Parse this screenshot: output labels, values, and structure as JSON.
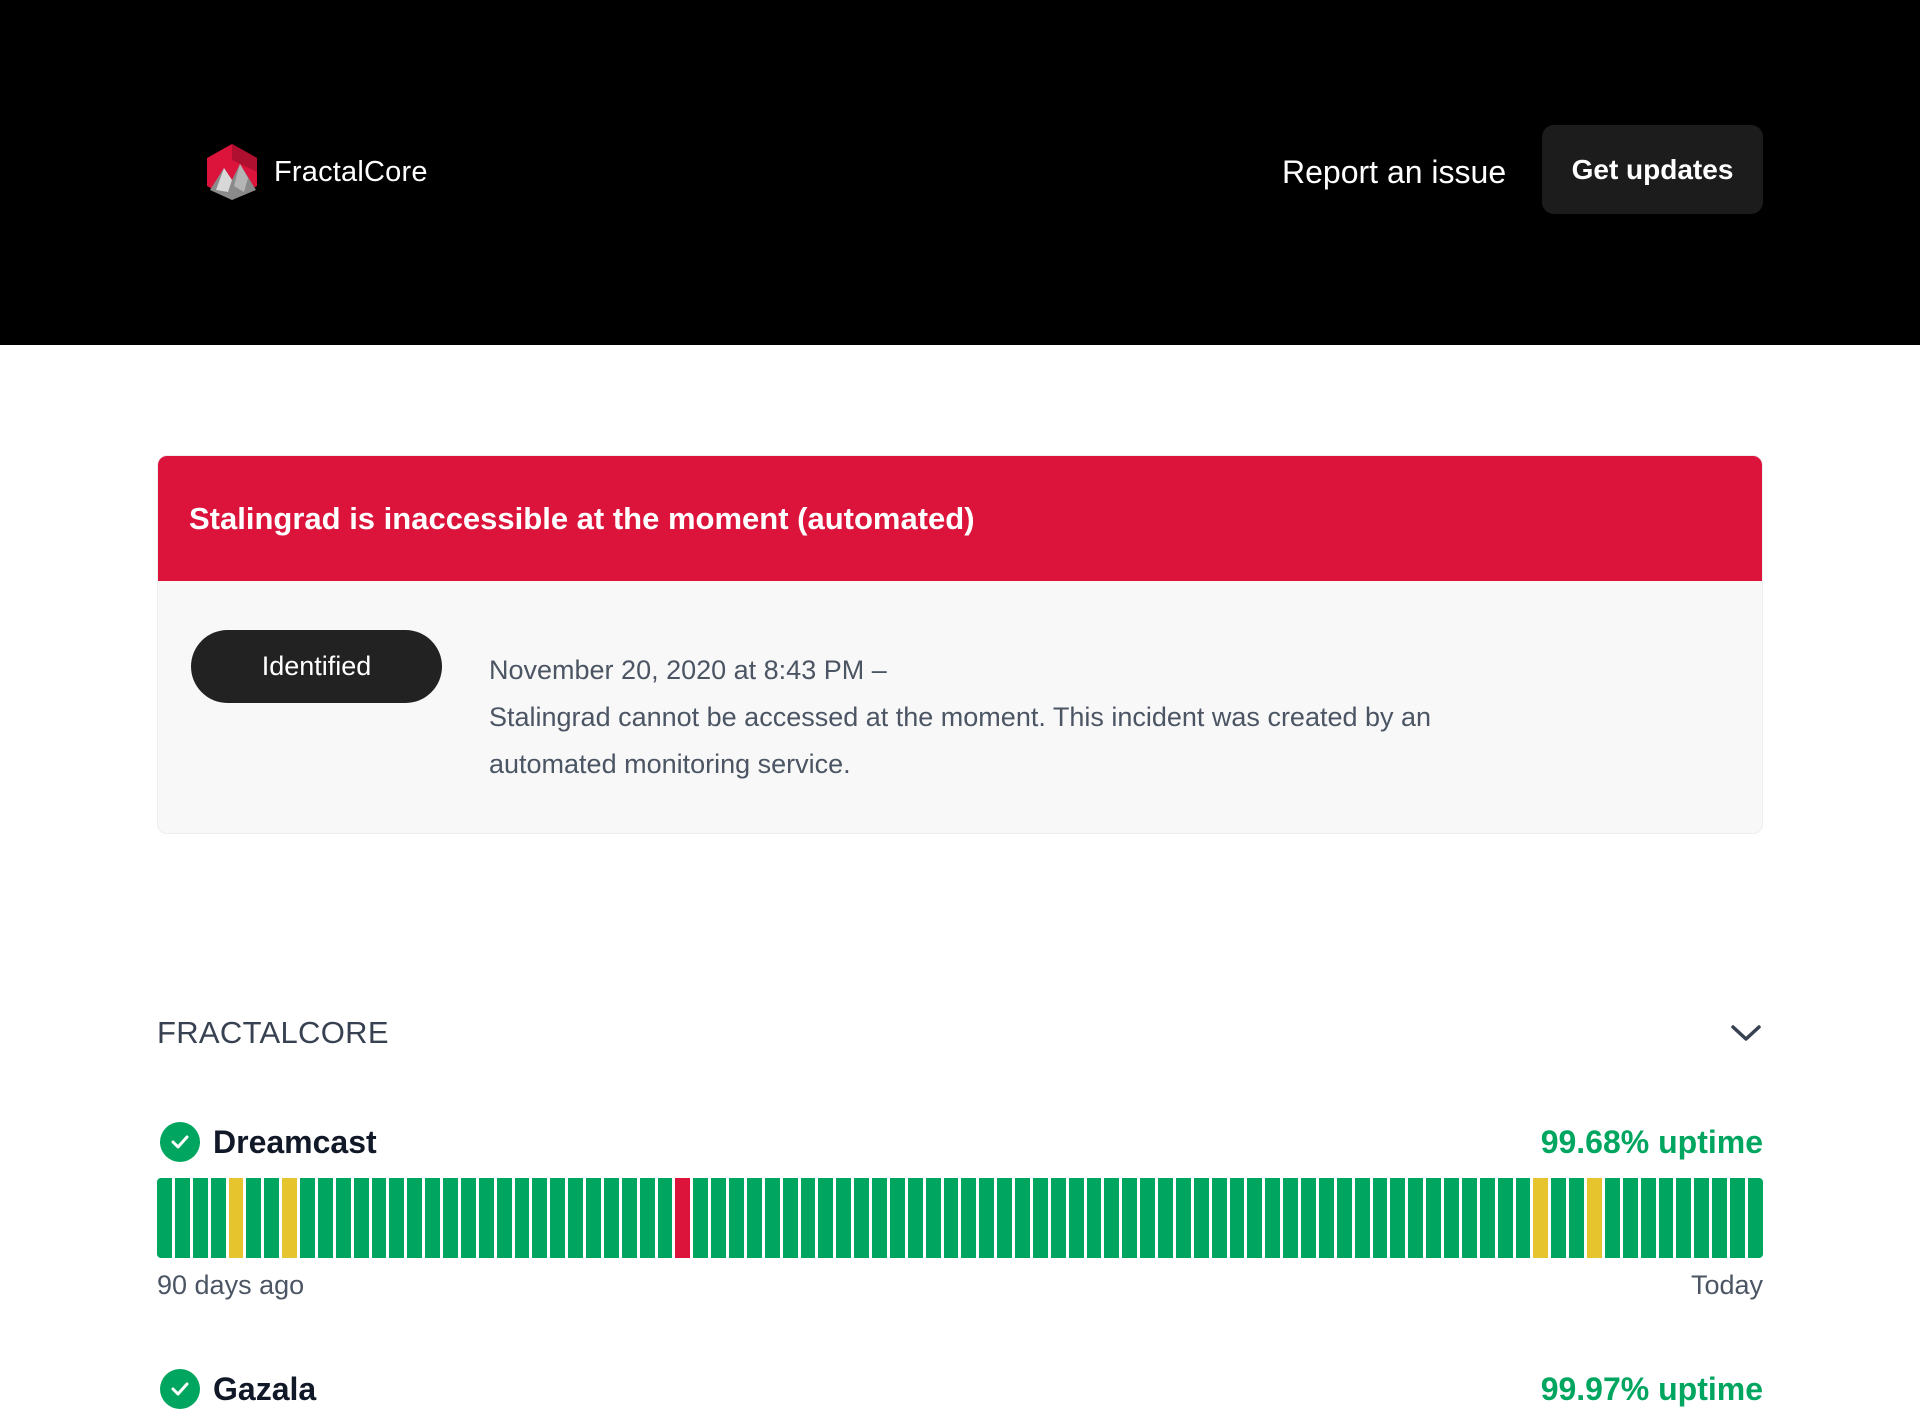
{
  "header": {
    "brand_name": "FractalCore",
    "logo_icon": "fractalcore-hexagon-logo",
    "report_link": "Report an issue",
    "updates_button": "Get updates"
  },
  "colors": {
    "header_bg": "#000000",
    "incident_red": "#dc143c",
    "up_green": "#00a65f",
    "warn_yellow": "#e6c42e"
  },
  "incident": {
    "title": "Stalingrad is inaccessible at the moment (automated)",
    "status": "Identified",
    "date": "November 20, 2020 at 8:43 PM  –",
    "message": "Stalingrad cannot be accessed at the moment. This incident was created by an automated monitoring service."
  },
  "group": {
    "title": "FRACTALCORE",
    "toggle_icon": "chevron-down-icon"
  },
  "components": [
    {
      "name": "Dreamcast",
      "uptime": "99.68% uptime",
      "status_icon": "check-circle-icon",
      "history_days": 90,
      "yellow_days": [
        4,
        7,
        77,
        80
      ],
      "red_days": [
        29
      ],
      "axis_start": "90 days ago",
      "axis_end": "Today"
    },
    {
      "name": "Gazala",
      "uptime": "99.97% uptime",
      "status_icon": "check-circle-icon"
    }
  ]
}
